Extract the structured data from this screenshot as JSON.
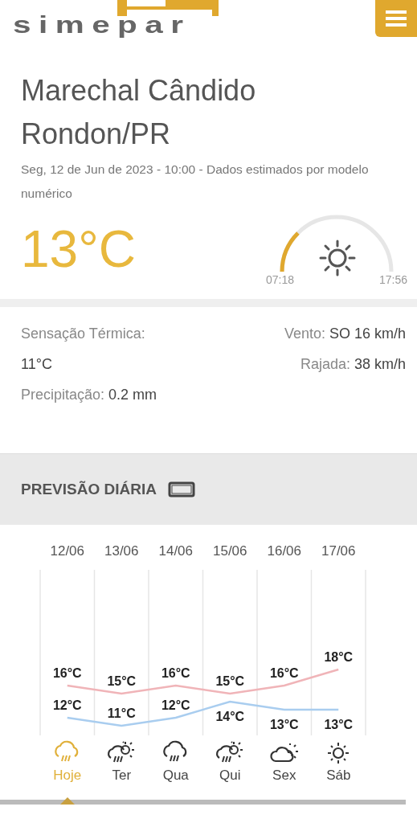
{
  "header": {
    "logo": "simepar"
  },
  "location": {
    "city": "Marechal Cândido Rondon/PR",
    "subtitle": "Seg, 12 de Jun de 2023 - 10:00 - Dados estimados por modelo numérico"
  },
  "current": {
    "temperature": "13°C",
    "sun": {
      "sunrise": "07:18",
      "sunset": "17:56"
    }
  },
  "details": {
    "left": [
      {
        "label": "Sensação Térmica:",
        "value": "11°C"
      },
      {
        "label": "Precipitação:",
        "value": "0.2 mm"
      }
    ],
    "right": [
      {
        "label": "Vento:",
        "value": "SO 16 km/h"
      },
      {
        "label": "Rajada:",
        "value": "38 km/h"
      }
    ]
  },
  "forecast": {
    "title": "PREVISÃO DIÁRIA",
    "chart_data": {
      "type": "line",
      "categories": [
        "12/06",
        "13/06",
        "14/06",
        "15/06",
        "16/06",
        "17/06"
      ],
      "series": [
        {
          "color": "#f0b4b8",
          "values": [
            16,
            15,
            16,
            15,
            16,
            18
          ],
          "value_labels": [
            "16°C",
            "15°C",
            "16°C",
            "15°C",
            "16°C",
            "18°C"
          ]
        },
        {
          "color": "#a9cdef",
          "values": [
            12,
            11,
            12,
            14,
            13,
            13
          ],
          "value_labels": [
            "12°C",
            "11°C",
            "12°C",
            "14°C",
            "13°C",
            "13°C"
          ]
        }
      ]
    },
    "days": [
      {
        "day": "Hoje",
        "kind": "rain",
        "selected": true
      },
      {
        "day": "Ter",
        "kind": "rain-sun",
        "selected": false
      },
      {
        "day": "Qua",
        "kind": "rain",
        "selected": false
      },
      {
        "day": "Qui",
        "kind": "rain-sun",
        "selected": false
      },
      {
        "day": "Sex",
        "kind": "cloud-sun",
        "selected": false
      },
      {
        "day": "Sáb",
        "kind": "sun",
        "selected": false
      }
    ]
  }
}
